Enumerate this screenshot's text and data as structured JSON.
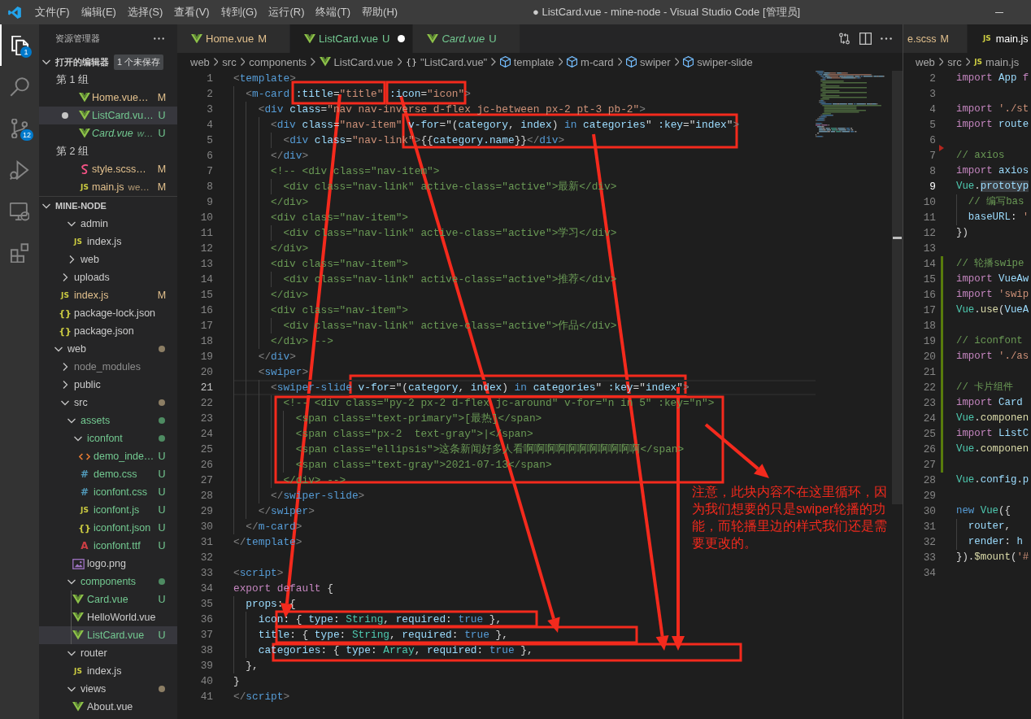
{
  "title_bar": {
    "menus": [
      "文件(F)",
      "编辑(E)",
      "选择(S)",
      "查看(V)",
      "转到(G)",
      "运行(R)",
      "终端(T)",
      "帮助(H)"
    ],
    "title": "● ListCard.vue - mine-node - Visual Studio Code [管理员]"
  },
  "activity_bar": [
    {
      "kind": "files",
      "selected": true,
      "badge": "1"
    },
    {
      "kind": "search",
      "selected": false
    },
    {
      "kind": "source-control",
      "selected": false,
      "badge": "12"
    },
    {
      "kind": "run",
      "selected": false
    },
    {
      "kind": "remote",
      "selected": false
    },
    {
      "kind": "extensions",
      "selected": false
    }
  ],
  "sidebar": {
    "title": "资源管理器",
    "open_editors": {
      "title": "打开的编辑器",
      "expanded": true,
      "badge": "1 个未保存",
      "groups": [
        {
          "label": "第 1 组",
          "files": [
            {
              "label": "Home.vue…",
              "kind": "vue",
              "modified": true,
              "untracked": false,
              "badge": "M",
              "dirty": false,
              "preview": false,
              "selected": false
            },
            {
              "label": "ListCard.vu…",
              "kind": "vue",
              "untracked": true,
              "badge": "U",
              "dirty": true,
              "preview": false,
              "selected": true
            },
            {
              "label": "Card.vue",
              "description": "w…",
              "kind": "vue",
              "untracked": true,
              "badge": "U",
              "dirty": false,
              "preview": true,
              "selected": false
            }
          ]
        },
        {
          "label": "第 2 组",
          "files": [
            {
              "label": "style.scss…",
              "kind": "scss",
              "modified": true,
              "untracked": false,
              "badge": "M",
              "dirty": false,
              "preview": false,
              "selected": false
            },
            {
              "label": "main.js",
              "description": "we…",
              "kind": "js",
              "glyph": "JS",
              "modified": true,
              "untracked": false,
              "badge": "M",
              "dirty": false,
              "preview": false,
              "selected": false
            }
          ]
        }
      ]
    },
    "folder": {
      "title": "MINE-NODE",
      "expanded": true,
      "tree": [
        {
          "children": [
            {
              "children": [
                {
                  "kind": "folder",
                  "label": "admin",
                  "expanded": true,
                  "modified": false,
                  "untracked": false,
                  "ignored": false,
                  "selected": false,
                  "children": [
                    {
                      "kind": "js",
                      "label": "index.js",
                      "glyph": "JS",
                      "modified": false,
                      "untracked": false,
                      "ignored": false,
                      "selected": false
                    }
                  ]
                },
                {
                  "kind": "folder",
                  "label": "web",
                  "expanded": false,
                  "modified": false,
                  "untracked": false,
                  "ignored": false,
                  "selected": false
                }
              ]
            },
            {
              "kind": "folder",
              "label": "uploads",
              "expanded": false,
              "modified": false,
              "untracked": false,
              "ignored": false,
              "selected": false
            },
            {
              "kind": "js",
              "label": "index.js",
              "glyph": "JS",
              "modified": true,
              "untracked": false,
              "ignored": false,
              "badge": "M",
              "selected": false
            },
            {
              "kind": "json",
              "label": "package-lock.json",
              "glyph": "{}",
              "modified": false,
              "untracked": false,
              "ignored": false,
              "selected": false
            },
            {
              "kind": "json",
              "label": "package.json",
              "glyph": "{}",
              "modified": false,
              "untracked": false,
              "ignored": false,
              "selected": false
            }
          ]
        },
        {
          "kind": "folder",
          "label": "web",
          "expanded": true,
          "color": "#8c7e64",
          "modified": false,
          "untracked": false,
          "ignored": false,
          "selected": false,
          "children": [
            {
              "kind": "folder",
              "label": "node_modules",
              "expanded": false,
              "ignored": true,
              "selected": false
            },
            {
              "kind": "folder",
              "label": "public",
              "expanded": false,
              "modified": false,
              "untracked": false,
              "ignored": false,
              "selected": false
            },
            {
              "kind": "folder",
              "label": "src",
              "expanded": true,
              "color": "#8c7e64",
              "modified": false,
              "untracked": false,
              "ignored": false,
              "selected": false,
              "children": [
                {
                  "kind": "folder",
                  "label": "assets",
                  "expanded": true,
                  "color": "#4e8b62",
                  "untracked": true,
                  "ignored": false,
                  "selected": false,
                  "children": [
                    {
                      "kind": "folder",
                      "label": "iconfont",
                      "expanded": true,
                      "color": "#4e8b62",
                      "untracked": true,
                      "ignored": false,
                      "selected": false,
                      "children": [
                        {
                          "kind": "html",
                          "label": "demo_inde…",
                          "untracked": true,
                          "ignored": false,
                          "badge": "U",
                          "selected": false
                        },
                        {
                          "kind": "css",
                          "label": "demo.css",
                          "glyph": "#",
                          "untracked": true,
                          "ignored": false,
                          "badge": "U",
                          "selected": false
                        },
                        {
                          "kind": "css",
                          "label": "iconfont.css",
                          "glyph": "#",
                          "untracked": true,
                          "ignored": false,
                          "badge": "U",
                          "selected": false
                        },
                        {
                          "kind": "js",
                          "label": "iconfont.js",
                          "glyph": "JS",
                          "untracked": true,
                          "ignored": false,
                          "badge": "U",
                          "selected": false
                        },
                        {
                          "kind": "json",
                          "label": "iconfont.json",
                          "glyph": "{}",
                          "untracked": true,
                          "ignored": false,
                          "badge": "U",
                          "selected": false
                        },
                        {
                          "kind": "font",
                          "label": "iconfont.ttf",
                          "glyph": "A",
                          "untracked": true,
                          "ignored": false,
                          "badge": "U",
                          "selected": false
                        }
                      ]
                    },
                    {
                      "kind": "image",
                      "label": "logo.png",
                      "modified": false,
                      "untracked": false,
                      "ignored": false,
                      "selected": false
                    }
                  ]
                },
                {
                  "kind": "folder",
                  "label": "components",
                  "expanded": true,
                  "color": "#4e8b62",
                  "untracked": true,
                  "ignored": false,
                  "selected": false,
                  "children": [
                    {
                      "kind": "vue",
                      "label": "Card.vue",
                      "untracked": true,
                      "ignored": false,
                      "badge": "U",
                      "selected": false
                    },
                    {
                      "kind": "vue",
                      "label": "HelloWorld.vue",
                      "modified": false,
                      "untracked": false,
                      "ignored": false,
                      "selected": false
                    },
                    {
                      "kind": "vue",
                      "label": "ListCard.vue",
                      "untracked": true,
                      "ignored": false,
                      "badge": "U",
                      "selected": true
                    }
                  ]
                },
                {
                  "kind": "folder",
                  "label": "router",
                  "expanded": true,
                  "modified": false,
                  "untracked": false,
                  "ignored": false,
                  "selected": false,
                  "children": [
                    {
                      "kind": "js",
                      "label": "index.js",
                      "glyph": "JS",
                      "modified": false,
                      "untracked": false,
                      "ignored": false,
                      "selected": false
                    }
                  ]
                },
                {
                  "kind": "folder",
                  "label": "views",
                  "expanded": true,
                  "color": "#8c7e64",
                  "modified": false,
                  "untracked": false,
                  "ignored": false,
                  "selected": false,
                  "children": [
                    {
                      "kind": "vue",
                      "label": "About.vue",
                      "modified": false,
                      "untracked": false,
                      "ignored": false,
                      "selected": false
                    }
                  ]
                }
              ]
            }
          ]
        }
      ]
    }
  },
  "editor_left": {
    "tabs": [
      {
        "label": "Home.vue",
        "kind": "vue",
        "modified": true,
        "untracked": false,
        "badge": "M",
        "selected": false,
        "dirty": false,
        "preview": false
      },
      {
        "label": "ListCard.vue",
        "kind": "vue",
        "untracked": true,
        "badge": "U",
        "selected": true,
        "dirty": true,
        "preview": false
      },
      {
        "label": "Card.vue",
        "kind": "vue",
        "untracked": true,
        "badge": "U",
        "selected": false,
        "dirty": false,
        "preview": true
      }
    ],
    "breadcrumb": [
      {
        "label": "web",
        "kind": "folder"
      },
      {
        "label": "src",
        "kind": "folder"
      },
      {
        "label": "components",
        "kind": "folder"
      },
      {
        "label": "ListCard.vue",
        "kind": "vue"
      },
      {
        "label": "\"ListCard.vue\"",
        "kind": "module",
        "glyph": "{}"
      },
      {
        "label": "template",
        "kind": "element"
      },
      {
        "label": "m-card",
        "kind": "element"
      },
      {
        "label": "swiper",
        "kind": "element"
      },
      {
        "label": "swiper-slide",
        "kind": "element"
      }
    ],
    "lines": [
      {
        "number": "1",
        "current": false,
        "tokens": [
          {
            "kind": "br",
            "text": "<"
          },
          {
            "kind": "tag",
            "text": "template"
          },
          {
            "kind": "br",
            "text": ">"
          }
        ]
      },
      {
        "number": "2",
        "current": false,
        "tokens": [
          {
            "kind": "br",
            "text": "  <"
          },
          {
            "kind": "tag",
            "text": "m-card"
          },
          {
            "kind": "attr",
            "text": " :title"
          },
          {
            "kind": "p",
            "text": "="
          },
          {
            "kind": "str",
            "text": "\"title\""
          },
          {
            "kind": "attr",
            "text": " :icon"
          },
          {
            "kind": "p",
            "text": "="
          },
          {
            "kind": "str",
            "text": "\"icon\""
          },
          {
            "kind": "br",
            "text": ">"
          }
        ]
      },
      {
        "number": "3",
        "current": false,
        "tokens": [
          {
            "kind": "br",
            "text": "    <"
          },
          {
            "kind": "tag",
            "text": "div"
          },
          {
            "kind": "attr",
            "text": " class"
          },
          {
            "kind": "p",
            "text": "="
          },
          {
            "kind": "str",
            "text": "\"nav nav-inverse d-flex jc-between px-2 pt-3 pb-2\""
          },
          {
            "kind": "br",
            "text": ">"
          }
        ]
      },
      {
        "number": "4",
        "current": false,
        "tokens": [
          {
            "kind": "br",
            "text": "      <"
          },
          {
            "kind": "tag",
            "text": "div"
          },
          {
            "kind": "attr",
            "text": " class"
          },
          {
            "kind": "p",
            "text": "="
          },
          {
            "kind": "str",
            "text": "\"nav-item\""
          },
          {
            "kind": "attr",
            "text": " v-for"
          },
          {
            "kind": "p",
            "text": "=\"("
          },
          {
            "kind": "var",
            "text": "category"
          },
          {
            "kind": "p",
            "text": ", "
          },
          {
            "kind": "var",
            "text": "index"
          },
          {
            "kind": "p",
            "text": ") "
          },
          {
            "kind": "kw",
            "text": "in"
          },
          {
            "kind": "var",
            "text": " categories"
          },
          {
            "kind": "p",
            "text": "\""
          },
          {
            "kind": "attr",
            "text": " :key"
          },
          {
            "kind": "p",
            "text": "=\""
          },
          {
            "kind": "var",
            "text": "index"
          },
          {
            "kind": "p",
            "text": "\""
          },
          {
            "kind": "br",
            "text": ">"
          }
        ]
      },
      {
        "number": "5",
        "current": false,
        "tokens": [
          {
            "kind": "br",
            "text": "        <"
          },
          {
            "kind": "tag",
            "text": "div"
          },
          {
            "kind": "attr",
            "text": " class"
          },
          {
            "kind": "p",
            "text": "="
          },
          {
            "kind": "str",
            "text": "\"nav-link\""
          },
          {
            "kind": "br",
            "text": ">"
          },
          {
            "kind": "p",
            "text": "{{"
          },
          {
            "kind": "var",
            "text": "category.name"
          },
          {
            "kind": "p",
            "text": "}}"
          },
          {
            "kind": "br",
            "text": "</"
          },
          {
            "kind": "tag",
            "text": "div"
          },
          {
            "kind": "br",
            "text": ">"
          }
        ]
      },
      {
        "number": "6",
        "current": false,
        "tokens": [
          {
            "kind": "br",
            "text": "      </"
          },
          {
            "kind": "tag",
            "text": "div"
          },
          {
            "kind": "br",
            "text": ">"
          }
        ]
      },
      {
        "number": "7",
        "current": false,
        "tokens": [
          {
            "kind": "cm",
            "text": "      <!-- <div class=\"nav-item\">"
          }
        ]
      },
      {
        "number": "8",
        "current": false,
        "tokens": [
          {
            "kind": "cm",
            "text": "        <div class=\"nav-link\" active-class=\"active\">最新</div>"
          }
        ]
      },
      {
        "number": "9",
        "current": false,
        "tokens": [
          {
            "kind": "cm",
            "text": "      </div>"
          }
        ]
      },
      {
        "number": "10",
        "current": false,
        "tokens": [
          {
            "kind": "cm",
            "text": "      <div class=\"nav-item\">"
          }
        ]
      },
      {
        "number": "11",
        "current": false,
        "tokens": [
          {
            "kind": "cm",
            "text": "        <div class=\"nav-link\" active-class=\"active\">学习</div>"
          }
        ]
      },
      {
        "number": "12",
        "current": false,
        "tokens": [
          {
            "kind": "cm",
            "text": "      </div>"
          }
        ]
      },
      {
        "number": "13",
        "current": false,
        "tokens": [
          {
            "kind": "cm",
            "text": "      <div class=\"nav-item\">"
          }
        ]
      },
      {
        "number": "14",
        "current": false,
        "tokens": [
          {
            "kind": "cm",
            "text": "        <div class=\"nav-link\" active-class=\"active\">推荐</div>"
          }
        ]
      },
      {
        "number": "15",
        "current": false,
        "tokens": [
          {
            "kind": "cm",
            "text": "      </div>"
          }
        ]
      },
      {
        "number": "16",
        "current": false,
        "tokens": [
          {
            "kind": "cm",
            "text": "      <div class=\"nav-item\">"
          }
        ]
      },
      {
        "number": "17",
        "current": false,
        "tokens": [
          {
            "kind": "cm",
            "text": "        <div class=\"nav-link\" active-class=\"active\">作品</div>"
          }
        ]
      },
      {
        "number": "18",
        "current": false,
        "tokens": [
          {
            "kind": "cm",
            "text": "      </div> -->"
          }
        ]
      },
      {
        "number": "19",
        "current": false,
        "tokens": [
          {
            "kind": "br",
            "text": "    </"
          },
          {
            "kind": "tag",
            "text": "div"
          },
          {
            "kind": "br",
            "text": ">"
          }
        ]
      },
      {
        "number": "20",
        "current": false,
        "tokens": [
          {
            "kind": "br",
            "text": "    <"
          },
          {
            "kind": "tag",
            "text": "swiper"
          },
          {
            "kind": "br",
            "text": ">"
          }
        ]
      },
      {
        "number": "21",
        "current": true,
        "tokens": [
          {
            "kind": "br",
            "text": "      <"
          },
          {
            "kind": "tag",
            "text": "swiper-slide"
          },
          {
            "kind": "attr",
            "text": " v-for"
          },
          {
            "kind": "p",
            "text": "=\"("
          },
          {
            "kind": "var",
            "text": "category"
          },
          {
            "kind": "p",
            "text": ", "
          },
          {
            "kind": "var",
            "text": "index"
          },
          {
            "kind": "p",
            "text": ") "
          },
          {
            "kind": "kw",
            "text": "in"
          },
          {
            "kind": "var",
            "text": " categories"
          },
          {
            "kind": "p",
            "text": "\""
          },
          {
            "kind": "attr",
            "text": " :key"
          },
          {
            "kind": "p",
            "text": "=\""
          },
          {
            "kind": "var",
            "text": "index"
          },
          {
            "kind": "p",
            "text": "\""
          },
          {
            "kind": "br",
            "text": ">"
          }
        ]
      },
      {
        "number": "22",
        "current": false,
        "tokens": [
          {
            "kind": "cm",
            "text": "        <!-- <div class=\"py-2 px-2 d-flex jc-around\" v-for=\"n in 5\" :key=\"n\">"
          }
        ]
      },
      {
        "number": "23",
        "current": false,
        "tokens": [
          {
            "kind": "cm",
            "text": "          <span class=\"text-primary\">[最热]</span>"
          }
        ]
      },
      {
        "number": "24",
        "current": false,
        "tokens": [
          {
            "kind": "cm",
            "text": "          <span class=\"px-2  text-gray\">|</span>"
          }
        ]
      },
      {
        "number": "25",
        "current": false,
        "tokens": [
          {
            "kind": "cm",
            "text": "          <span class=\"ellipsis\">这条新闻好多人看啊啊啊啊啊啊啊啊啊啊啊</span>"
          }
        ]
      },
      {
        "number": "26",
        "current": false,
        "tokens": [
          {
            "kind": "cm",
            "text": "          <span class=\"text-gray\">2021-07-13</span>"
          }
        ]
      },
      {
        "number": "27",
        "current": false,
        "tokens": [
          {
            "kind": "cm",
            "text": "        </div> -->"
          }
        ]
      },
      {
        "number": "28",
        "current": false,
        "tokens": [
          {
            "kind": "br",
            "text": "      </"
          },
          {
            "kind": "tag",
            "text": "swiper-slide"
          },
          {
            "kind": "br",
            "text": ">"
          }
        ]
      },
      {
        "number": "29",
        "current": false,
        "tokens": [
          {
            "kind": "br",
            "text": "    </"
          },
          {
            "kind": "tag",
            "text": "swiper"
          },
          {
            "kind": "br",
            "text": ">"
          }
        ]
      },
      {
        "number": "30",
        "current": false,
        "tokens": [
          {
            "kind": "br",
            "text": "  </"
          },
          {
            "kind": "tag",
            "text": "m-card"
          },
          {
            "kind": "br",
            "text": ">"
          }
        ]
      },
      {
        "number": "31",
        "current": false,
        "tokens": [
          {
            "kind": "br",
            "text": "</"
          },
          {
            "kind": "tag",
            "text": "template"
          },
          {
            "kind": "br",
            "text": ">"
          }
        ]
      },
      {
        "number": "32",
        "current": false
      },
      {
        "number": "33",
        "current": false,
        "tokens": [
          {
            "kind": "br",
            "text": "<"
          },
          {
            "kind": "tag",
            "text": "script"
          },
          {
            "kind": "br",
            "text": ">"
          }
        ]
      },
      {
        "number": "34",
        "current": false,
        "tokens": [
          {
            "kind": "ctl",
            "text": "export"
          },
          {
            "kind": "ctl",
            "text": " default"
          },
          {
            "kind": "p",
            "text": " {"
          }
        ]
      },
      {
        "number": "35",
        "current": false,
        "tokens": [
          {
            "kind": "var",
            "text": "  props"
          },
          {
            "kind": "p",
            "text": ": {"
          }
        ]
      },
      {
        "number": "36",
        "current": false,
        "tokens": [
          {
            "kind": "var",
            "text": "    icon"
          },
          {
            "kind": "p",
            "text": ": { "
          },
          {
            "kind": "var",
            "text": "type"
          },
          {
            "kind": "p",
            "text": ": "
          },
          {
            "kind": "type",
            "text": "String"
          },
          {
            "kind": "p",
            "text": ", "
          },
          {
            "kind": "var",
            "text": "required"
          },
          {
            "kind": "p",
            "text": ": "
          },
          {
            "kind": "kw",
            "text": "true"
          },
          {
            "kind": "p",
            "text": " },"
          }
        ]
      },
      {
        "number": "37",
        "current": false,
        "tokens": [
          {
            "kind": "var",
            "text": "    title"
          },
          {
            "kind": "p",
            "text": ": { "
          },
          {
            "kind": "var",
            "text": "type"
          },
          {
            "kind": "p",
            "text": ": "
          },
          {
            "kind": "type",
            "text": "String"
          },
          {
            "kind": "p",
            "text": ", "
          },
          {
            "kind": "var",
            "text": "required"
          },
          {
            "kind": "p",
            "text": ": "
          },
          {
            "kind": "kw",
            "text": "true"
          },
          {
            "kind": "p",
            "text": " },"
          }
        ]
      },
      {
        "number": "38",
        "current": false,
        "tokens": [
          {
            "kind": "var",
            "text": "    categories"
          },
          {
            "kind": "p",
            "text": ": { "
          },
          {
            "kind": "var",
            "text": "type"
          },
          {
            "kind": "p",
            "text": ": "
          },
          {
            "kind": "type",
            "text": "Array"
          },
          {
            "kind": "p",
            "text": ", "
          },
          {
            "kind": "var",
            "text": "required"
          },
          {
            "kind": "p",
            "text": ": "
          },
          {
            "kind": "kw",
            "text": "true"
          },
          {
            "kind": "p",
            "text": " },"
          }
        ]
      },
      {
        "number": "39",
        "current": false,
        "tokens": [
          {
            "kind": "p",
            "text": "  },"
          }
        ]
      },
      {
        "number": "40",
        "current": false,
        "tokens": [
          {
            "kind": "p",
            "text": "}"
          }
        ]
      },
      {
        "number": "41",
        "current": false,
        "tokens": [
          {
            "kind": "br",
            "text": "</"
          },
          {
            "kind": "tag",
            "text": "script"
          },
          {
            "kind": "br",
            "text": ">"
          }
        ]
      }
    ]
  },
  "editor_right": {
    "tabs": [
      {
        "label": "e.scss",
        "modified": true,
        "untracked": false,
        "badge": "M",
        "selected": false,
        "dirty": false,
        "preview": false
      },
      {
        "label": "main.js",
        "kind": "js",
        "glyph": "JS",
        "modified": false,
        "untracked": false,
        "selected": true,
        "dirty": false,
        "preview": false
      }
    ],
    "breadcrumb": [
      {
        "label": "web",
        "kind": "folder"
      },
      {
        "label": "src",
        "kind": "folder"
      },
      {
        "label": "main.js",
        "kind": "js",
        "glyph": "JS"
      }
    ],
    "lines": [
      {
        "number": "2",
        "kind": "plain",
        "current": false,
        "tokens": [
          {
            "kind": "ctl",
            "text": "import"
          },
          {
            "kind": "var",
            "text": " App"
          },
          {
            "kind": "ctl",
            "text": " f"
          }
        ]
      },
      {
        "number": "3",
        "kind": "plain",
        "current": false
      },
      {
        "number": "4",
        "kind": "plain",
        "current": false,
        "tokens": [
          {
            "kind": "ctl",
            "text": "import"
          },
          {
            "kind": "str",
            "text": " './st"
          }
        ]
      },
      {
        "number": "5",
        "kind": "plain",
        "current": false,
        "tokens": [
          {
            "kind": "ctl",
            "text": "import"
          },
          {
            "kind": "var",
            "text": " route"
          }
        ]
      },
      {
        "number": "6",
        "kind": "plain",
        "current": false
      },
      {
        "number": "7",
        "kind": "deleted",
        "current": false,
        "tokens": [
          {
            "kind": "cm",
            "text": "// axios"
          }
        ]
      },
      {
        "number": "8",
        "kind": "plain",
        "current": false,
        "tokens": [
          {
            "kind": "ctl",
            "text": "import"
          },
          {
            "kind": "var",
            "text": " axios"
          }
        ]
      },
      {
        "number": "9",
        "kind": "plain",
        "current": true,
        "tokens": [
          {
            "kind": "type",
            "text": "Vue"
          },
          {
            "kind": "p",
            "text": "."
          },
          {
            "kind": "highlight",
            "text": "prototyp"
          }
        ]
      },
      {
        "number": "10",
        "kind": "plain",
        "current": false,
        "tokens": [
          {
            "kind": "cm",
            "text": "  // 编写bas"
          }
        ]
      },
      {
        "number": "11",
        "kind": "plain",
        "current": false,
        "tokens": [
          {
            "kind": "var",
            "text": "  baseURL"
          },
          {
            "kind": "p",
            "text": ": "
          },
          {
            "kind": "str",
            "text": "'"
          }
        ]
      },
      {
        "number": "12",
        "kind": "plain",
        "current": false,
        "tokens": [
          {
            "kind": "p",
            "text": "})"
          }
        ]
      },
      {
        "number": "13",
        "kind": "plain",
        "current": false
      },
      {
        "number": "14",
        "kind": "added",
        "current": false,
        "tokens": [
          {
            "kind": "cm",
            "text": "// 轮播swipe"
          }
        ]
      },
      {
        "number": "15",
        "kind": "added",
        "current": false,
        "tokens": [
          {
            "kind": "ctl",
            "text": "import"
          },
          {
            "kind": "var",
            "text": " VueAw"
          }
        ]
      },
      {
        "number": "16",
        "kind": "added",
        "current": false,
        "tokens": [
          {
            "kind": "ctl",
            "text": "import"
          },
          {
            "kind": "str",
            "text": " 'swip"
          }
        ]
      },
      {
        "number": "17",
        "kind": "added",
        "current": false,
        "tokens": [
          {
            "kind": "type",
            "text": "Vue"
          },
          {
            "kind": "p",
            "text": "."
          },
          {
            "kind": "fn",
            "text": "use"
          },
          {
            "kind": "p",
            "text": "("
          },
          {
            "kind": "var",
            "text": "VueA"
          }
        ]
      },
      {
        "number": "18",
        "kind": "added",
        "current": false
      },
      {
        "number": "19",
        "kind": "added",
        "current": false,
        "tokens": [
          {
            "kind": "cm",
            "text": "// iconfont"
          }
        ]
      },
      {
        "number": "20",
        "kind": "added",
        "current": false,
        "tokens": [
          {
            "kind": "ctl",
            "text": "import"
          },
          {
            "kind": "str",
            "text": " './as"
          }
        ]
      },
      {
        "number": "21",
        "kind": "added",
        "current": false
      },
      {
        "number": "22",
        "kind": "added",
        "current": false,
        "tokens": [
          {
            "kind": "cm",
            "text": "// 卡片组件"
          }
        ]
      },
      {
        "number": "23",
        "kind": "added",
        "current": false,
        "tokens": [
          {
            "kind": "ctl",
            "text": "import"
          },
          {
            "kind": "var",
            "text": " Card"
          }
        ]
      },
      {
        "number": "24",
        "kind": "added",
        "current": false,
        "tokens": [
          {
            "kind": "type",
            "text": "Vue"
          },
          {
            "kind": "p",
            "text": "."
          },
          {
            "kind": "fn",
            "text": "componen"
          }
        ]
      },
      {
        "number": "25",
        "kind": "added",
        "current": false,
        "tokens": [
          {
            "kind": "ctl",
            "text": "import"
          },
          {
            "kind": "var",
            "text": " ListC"
          }
        ]
      },
      {
        "number": "26",
        "kind": "added",
        "current": false,
        "tokens": [
          {
            "kind": "type",
            "text": "Vue"
          },
          {
            "kind": "p",
            "text": "."
          },
          {
            "kind": "fn",
            "text": "componen"
          }
        ]
      },
      {
        "number": "27",
        "kind": "added",
        "current": false
      },
      {
        "number": "28",
        "kind": "plain",
        "current": false,
        "tokens": [
          {
            "kind": "type",
            "text": "Vue"
          },
          {
            "kind": "p",
            "text": "."
          },
          {
            "kind": "var",
            "text": "config"
          },
          {
            "kind": "p",
            "text": "."
          },
          {
            "kind": "var",
            "text": "p"
          }
        ]
      },
      {
        "number": "29",
        "kind": "plain",
        "current": false
      },
      {
        "number": "30",
        "kind": "plain",
        "current": false,
        "tokens": [
          {
            "kind": "kw",
            "text": "new"
          },
          {
            "kind": "type",
            "text": " Vue"
          },
          {
            "kind": "p",
            "text": "({"
          }
        ]
      },
      {
        "number": "31",
        "kind": "plain",
        "current": false,
        "tokens": [
          {
            "kind": "var",
            "text": "  router"
          },
          {
            "kind": "p",
            "text": ","
          }
        ]
      },
      {
        "number": "32",
        "kind": "plain",
        "current": false,
        "tokens": [
          {
            "kind": "var",
            "text": "  render"
          },
          {
            "kind": "p",
            "text": ": "
          },
          {
            "kind": "var",
            "text": "h"
          }
        ]
      },
      {
        "number": "33",
        "kind": "plain",
        "current": false,
        "tokens": [
          {
            "kind": "p",
            "text": "})."
          },
          {
            "kind": "fn",
            "text": "$mount"
          },
          {
            "kind": "p",
            "text": "("
          },
          {
            "kind": "str",
            "text": "'#"
          }
        ]
      },
      {
        "number": "34",
        "kind": "plain",
        "current": false
      }
    ]
  },
  "annotation": {
    "note": "注意，此块内容不在这里循环，因为我们想要的只是swiper轮播的功能，而轮播里边的样式我们还是需要更改的。"
  }
}
